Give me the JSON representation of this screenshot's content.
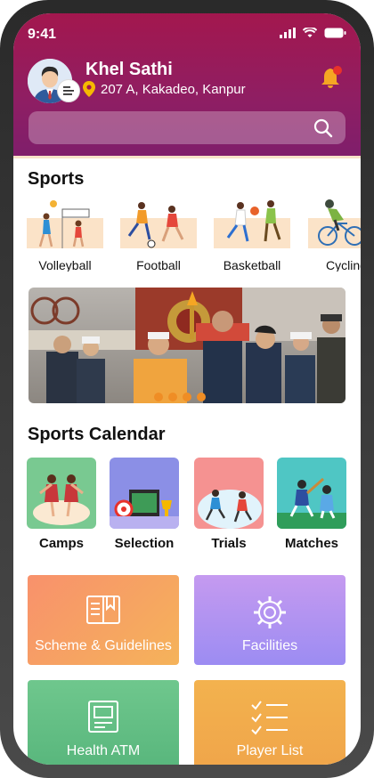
{
  "status": {
    "time": "9:41"
  },
  "header": {
    "app_title": "Khel Sathi",
    "location": "207 A, Kakadeo, Kanpur",
    "search_placeholder": ""
  },
  "sports": {
    "title": "Sports",
    "items": [
      {
        "label": "Volleyball"
      },
      {
        "label": "Football"
      },
      {
        "label": "Basketball"
      },
      {
        "label": "Cycling"
      }
    ]
  },
  "banner": {
    "slides": 4,
    "active": 0
  },
  "calendar": {
    "title": "Sports Calendar",
    "items": [
      {
        "label": "Camps",
        "color": "#79c991"
      },
      {
        "label": "Selection",
        "color": "#8b8fe6"
      },
      {
        "label": "Trials",
        "color": "#f59291"
      },
      {
        "label": "Matches",
        "color": "#4fc6c4"
      }
    ]
  },
  "cards": [
    {
      "label": "Scheme & Guidelines",
      "icon": "book-icon"
    },
    {
      "label": "Facilities",
      "icon": "gear-icon"
    },
    {
      "label": "Health ATM",
      "icon": "atm-icon"
    },
    {
      "label": "Player List",
      "icon": "checklist-icon"
    }
  ],
  "colors": {
    "header": "#a3174e",
    "accent": "#ef8d25",
    "bell": "#f5a623"
  }
}
